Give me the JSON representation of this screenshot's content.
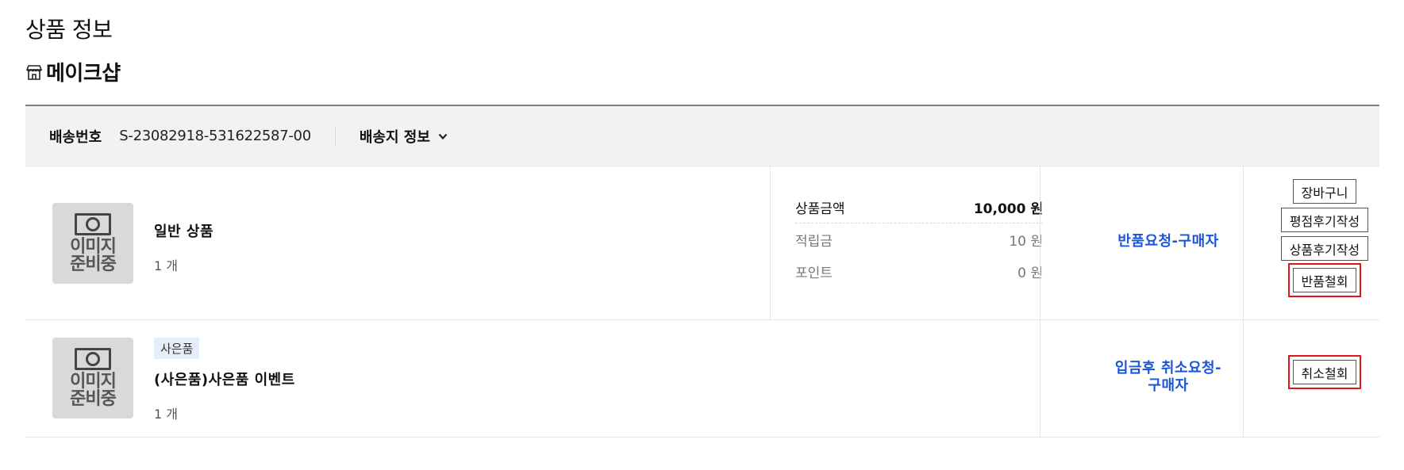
{
  "page": {
    "title": "상품 정보",
    "shop_name": "메이크샵"
  },
  "shipping": {
    "label": "배송번호",
    "number": "S-23082918-531622587-00",
    "toggle_label": "배송지 정보"
  },
  "items": [
    {
      "thumbnail_text": "이미지\n준비중",
      "badge": "",
      "name": "일반 상품",
      "quantity": "1 개",
      "price": {
        "amount_label": "상품금액",
        "amount": "10,000 원",
        "points_label": "적립금",
        "points": "10 원",
        "point_label": "포인트",
        "point": "0 원"
      },
      "status": "반품요청-구매자",
      "buttons": [
        "장바구니",
        "평점후기작성",
        "상품후기작성",
        "반품철회"
      ]
    },
    {
      "thumbnail_text": "이미지\n준비중",
      "badge": "사은품",
      "name": "(사은품)사은품 이벤트",
      "quantity": "1 개",
      "status": "입금후 취소요청-\n구매자",
      "buttons": [
        "취소철회"
      ]
    }
  ],
  "colors": {
    "status_blue": "#1a56d6",
    "highlight_red": "#e0161a",
    "header_bg": "#f2f2f2"
  }
}
